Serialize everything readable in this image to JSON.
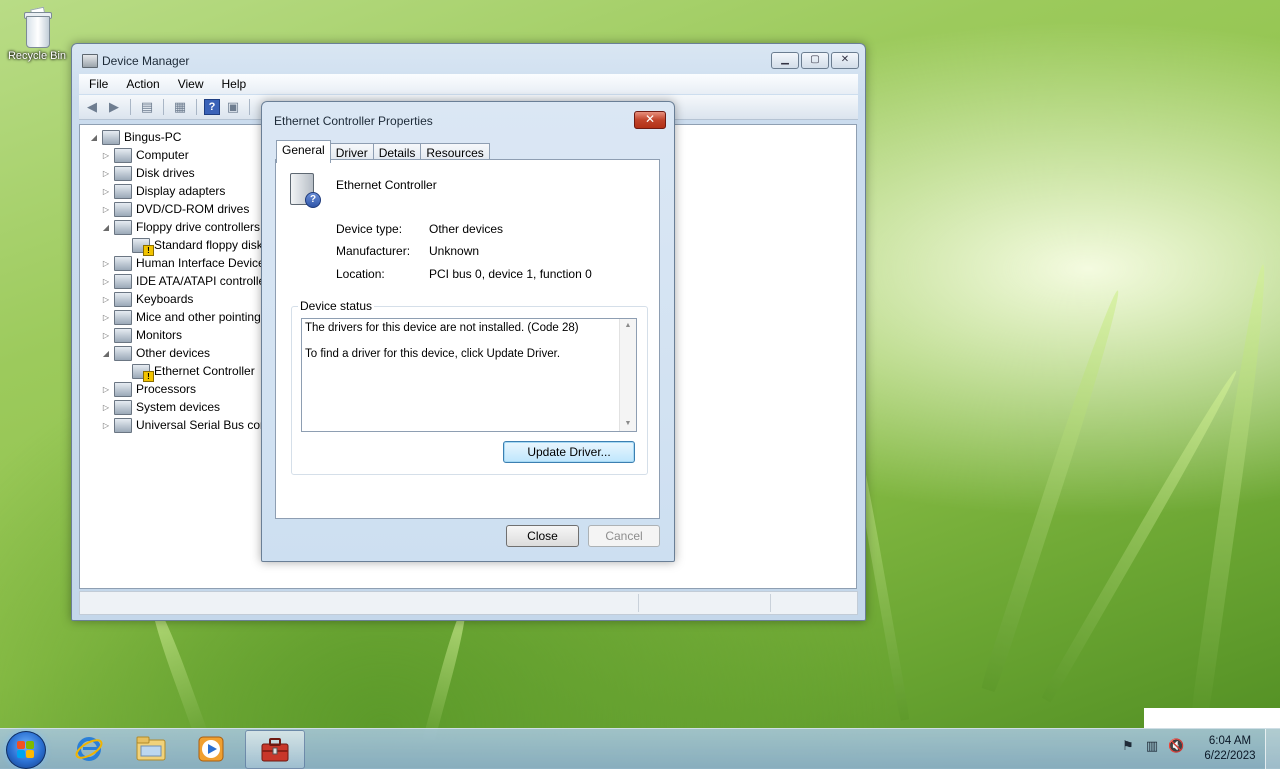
{
  "desktop": {
    "icons": [
      {
        "label": "Recycle Bin",
        "icon": "recycle-bin-icon"
      }
    ]
  },
  "device_manager": {
    "title": "Device Manager",
    "menu": [
      "File",
      "Action",
      "View",
      "Help"
    ],
    "toolbar": [
      "back-icon",
      "forward-icon",
      "show-hide-tree-icon",
      "properties-icon",
      "help-icon",
      "update-driver-icon",
      "scan-hardware-icon"
    ],
    "tree": {
      "root": "Bingus-PC",
      "items": [
        {
          "label": "Computer",
          "expanded": false,
          "icon": "computer-icon"
        },
        {
          "label": "Disk drives",
          "expanded": false,
          "icon": "disk-drive-icon"
        },
        {
          "label": "Display adapters",
          "expanded": false,
          "icon": "display-adapter-icon"
        },
        {
          "label": "DVD/CD-ROM drives",
          "expanded": false,
          "icon": "dvd-drive-icon"
        },
        {
          "label": "Floppy drive controllers",
          "expanded": true,
          "icon": "floppy-controller-icon"
        },
        {
          "label": "Standard floppy disk controller",
          "child": true,
          "warning": true,
          "icon": "floppy-controller-icon"
        },
        {
          "label": "Human Interface Devices",
          "expanded": false,
          "icon": "hid-icon"
        },
        {
          "label": "IDE ATA/ATAPI controllers",
          "expanded": false,
          "icon": "ide-controller-icon"
        },
        {
          "label": "Keyboards",
          "expanded": false,
          "icon": "keyboard-icon"
        },
        {
          "label": "Mice and other pointing devices",
          "expanded": false,
          "icon": "mouse-icon"
        },
        {
          "label": "Monitors",
          "expanded": false,
          "icon": "monitor-icon"
        },
        {
          "label": "Other devices",
          "expanded": true,
          "icon": "other-devices-icon"
        },
        {
          "label": "Ethernet Controller",
          "child": true,
          "warning": true,
          "icon": "ethernet-controller-icon"
        },
        {
          "label": "Processors",
          "expanded": false,
          "icon": "processor-icon"
        },
        {
          "label": "System devices",
          "expanded": false,
          "icon": "system-devices-icon"
        },
        {
          "label": "Universal Serial Bus controllers",
          "expanded": false,
          "icon": "usb-icon"
        }
      ]
    }
  },
  "properties_dialog": {
    "title": "Ethernet Controller Properties",
    "close_glyph": "✕",
    "tabs": [
      "General",
      "Driver",
      "Details",
      "Resources"
    ],
    "active_tab": "General",
    "device_name": "Ethernet Controller",
    "properties": [
      {
        "label": "Device type:",
        "value": "Other devices"
      },
      {
        "label": "Manufacturer:",
        "value": "Unknown"
      },
      {
        "label": "Location:",
        "value": "PCI bus 0, device 1, function 0"
      }
    ],
    "status_group_title": "Device status",
    "status_lines": [
      "The drivers for this device are not installed. (Code 28)",
      "To find a driver for this device, click Update Driver."
    ],
    "update_driver_label": "Update Driver...",
    "close_label": "Close",
    "cancel_label": "Cancel"
  },
  "taskbar": {
    "pinned": [
      {
        "name": "internet-explorer-icon"
      },
      {
        "name": "windows-explorer-icon"
      },
      {
        "name": "media-player-icon"
      },
      {
        "name": "device-manager-taskbar-icon",
        "active": true
      }
    ],
    "tray_icons": [
      "action-center-flag-icon",
      "network-icon",
      "volume-muted-icon"
    ],
    "clock": {
      "time": "6:04 AM",
      "date": "6/22/2023"
    }
  }
}
